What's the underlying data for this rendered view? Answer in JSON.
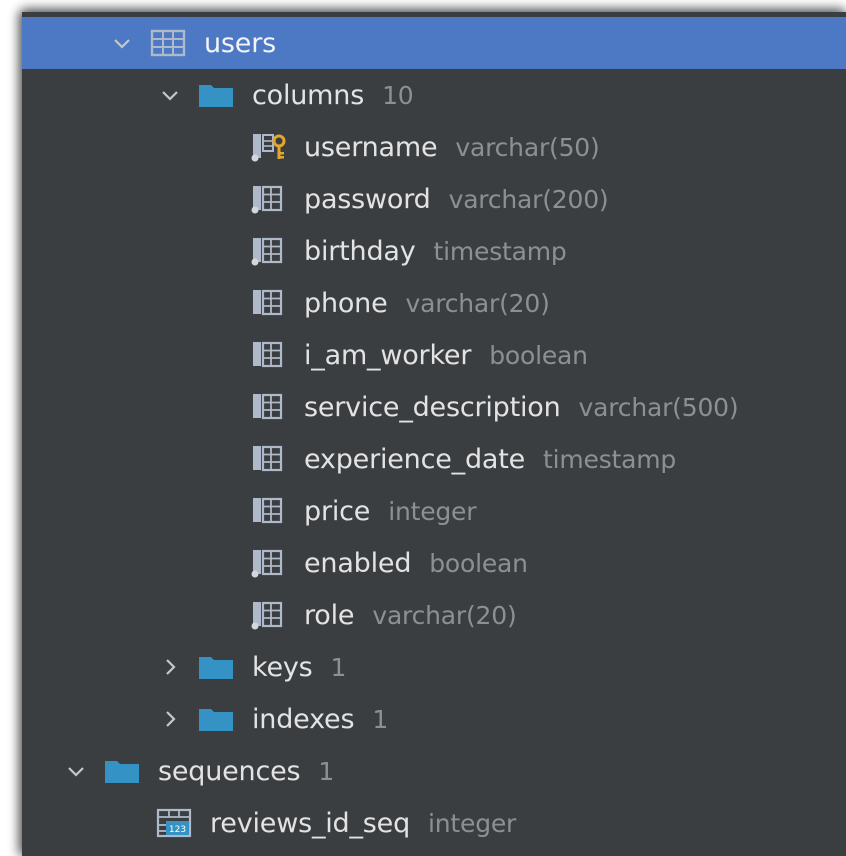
{
  "tree": {
    "table": {
      "label": "users"
    },
    "columns_folder": {
      "label": "columns",
      "count": "10"
    },
    "columns": [
      {
        "name": "username",
        "type": "varchar(50)",
        "icon": "key-column-icon"
      },
      {
        "name": "password",
        "type": "varchar(200)",
        "icon": "not-null-column-icon"
      },
      {
        "name": "birthday",
        "type": "timestamp",
        "icon": "not-null-column-icon"
      },
      {
        "name": "phone",
        "type": "varchar(20)",
        "icon": "column-icon"
      },
      {
        "name": "i_am_worker",
        "type": "boolean",
        "icon": "column-icon"
      },
      {
        "name": "service_description",
        "type": "varchar(500)",
        "icon": "column-icon"
      },
      {
        "name": "experience_date",
        "type": "timestamp",
        "icon": "column-icon"
      },
      {
        "name": "price",
        "type": "integer",
        "icon": "column-icon"
      },
      {
        "name": "enabled",
        "type": "boolean",
        "icon": "not-null-column-icon"
      },
      {
        "name": "role",
        "type": "varchar(20)",
        "icon": "not-null-column-icon"
      }
    ],
    "keys_folder": {
      "label": "keys",
      "count": "1"
    },
    "indexes_folder": {
      "label": "indexes",
      "count": "1"
    },
    "sequences_folder": {
      "label": "sequences",
      "count": "1"
    },
    "sequence": {
      "name": "reviews_id_seq",
      "type": "integer"
    }
  },
  "colors": {
    "selection": "#4d78c3",
    "background": "#3b3e41",
    "folder": "#3592c4",
    "text": "#e3e3e3",
    "muted": "#8e8f91"
  }
}
